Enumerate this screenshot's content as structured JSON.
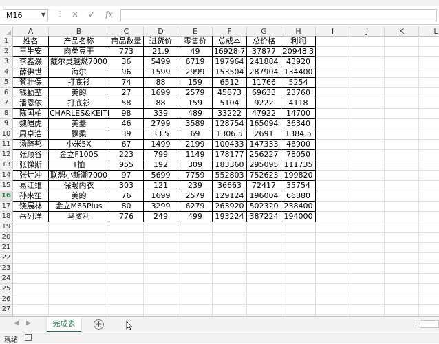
{
  "formula_bar": {
    "name_box": "M16",
    "cancel_icon": "✕",
    "enter_icon": "✓",
    "fx_label": "fx",
    "formula": ""
  },
  "columns": [
    "A",
    "B",
    "C",
    "D",
    "E",
    "F",
    "G",
    "H",
    "I",
    "J",
    "K",
    "L"
  ],
  "table": {
    "headers": [
      "姓名",
      "产品名称",
      "商品数量",
      "进货价",
      "零售价",
      "总成本",
      "总价格",
      "利润"
    ],
    "rows": [
      [
        "王生安",
        "肉类豆干",
        "773",
        "21.9",
        "49",
        "16928.7",
        "37877",
        "20948.3"
      ],
      [
        "李鑫灏",
        "戴尔灵越燃7000",
        "36",
        "5499",
        "6719",
        "197964",
        "241884",
        "43920"
      ],
      [
        "薛佛世",
        "海尔",
        "96",
        "1599",
        "2999",
        "153504",
        "287904",
        "134400"
      ],
      [
        "蔡壮保",
        "打底衫",
        "74",
        "88",
        "159",
        "6512",
        "11766",
        "5254"
      ],
      [
        "钱勤堃",
        "美的",
        "27",
        "1699",
        "2579",
        "45873",
        "69633",
        "23760"
      ],
      [
        "潘恩依",
        "打底衫",
        "58",
        "88",
        "159",
        "5104",
        "9222",
        "4118"
      ],
      [
        "陈国柏",
        "CHARLES&KEITH",
        "98",
        "339",
        "489",
        "33222",
        "47922",
        "14700"
      ],
      [
        "魏皑虎",
        "美菱",
        "46",
        "2799",
        "3589",
        "128754",
        "165094",
        "36340"
      ],
      [
        "周卓浩",
        "飘柔",
        "39",
        "33.5",
        "69",
        "1306.5",
        "2691",
        "1384.5"
      ],
      [
        "汤醉邦",
        "小米5X",
        "67",
        "1499",
        "2199",
        "100433",
        "147333",
        "46900"
      ],
      [
        "张顺谷",
        "金立F100S",
        "223",
        "799",
        "1149",
        "178177",
        "256227",
        "78050"
      ],
      [
        "张悌斯",
        "T恤",
        "955",
        "192",
        "309",
        "183360",
        "295095",
        "111735"
      ],
      [
        "张灶冲",
        "联想小新潮7000",
        "97",
        "5699",
        "7759",
        "552803",
        "752623",
        "199820"
      ],
      [
        "易江维",
        "保暖内衣",
        "303",
        "121",
        "239",
        "36663",
        "72417",
        "35754"
      ],
      [
        "孙来笙",
        "美的",
        "76",
        "1699",
        "2579",
        "129124",
        "196004",
        "66880"
      ],
      [
        "饶展林",
        "金立M65Plus",
        "80",
        "3299",
        "6279",
        "263920",
        "502320",
        "238400"
      ],
      [
        "岳列洋",
        "马爹利",
        "776",
        "249",
        "499",
        "193224",
        "387224",
        "194000"
      ]
    ]
  },
  "sheet_tabs": [
    {
      "label": "完成表",
      "active": true
    }
  ],
  "add_sheet_label": "+",
  "status_bar": {
    "ready": "就绪"
  }
}
